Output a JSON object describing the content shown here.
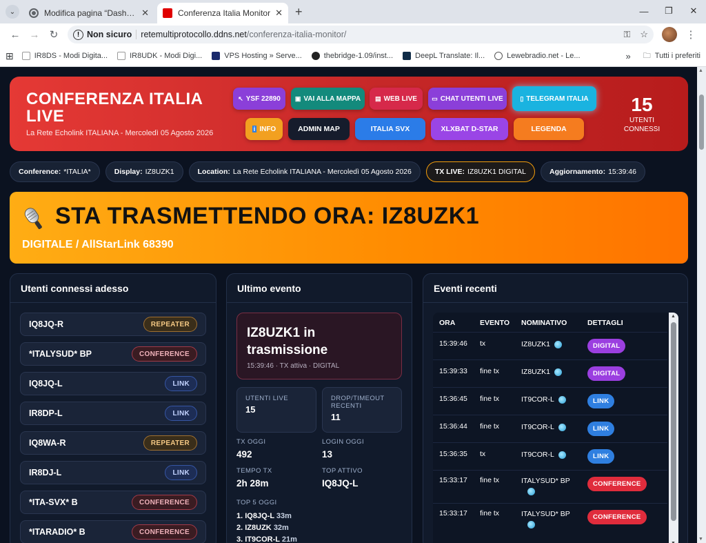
{
  "browser": {
    "tabs": [
      {
        "title": "Modifica pagina “Dashboard Li...",
        "close": "✕"
      },
      {
        "title": "Conferenza Italia Monitor",
        "close": "✕"
      }
    ],
    "new_tab": "+",
    "window_controls": {
      "minimize": "—",
      "restore": "❐",
      "close": "✕"
    },
    "address": {
      "security": "Non sicuro",
      "host": "retemultiprotocollo.ddns.net",
      "path": "/conferenza-italia-monitor/"
    },
    "bookmarks": [
      {
        "label": "IR8DS - Modi Digita..."
      },
      {
        "label": "IR8UDK - Modi Digi..."
      },
      {
        "label": "VPS Hosting » Serve..."
      },
      {
        "label": "thebridge-1.09/inst..."
      },
      {
        "label": "DeepL Translate: Il..."
      },
      {
        "label": "Lewebradio.net - Le..."
      }
    ],
    "bookmarks_overflow": "»",
    "bookmarks_folder": "Tutti i preferiti"
  },
  "hero": {
    "title_line1": "CONFERENZA ITALIA",
    "title_line2": "LIVE",
    "subtitle": "La Rete Echolink ITALIANA - Mercoledì 05 Agosto 2026",
    "buttons": {
      "ysf": "YSF 22890",
      "mappa": "VAI ALLA MAPPA",
      "weblive": "WEB LIVE",
      "chat": "CHAT UTENTI LIVE",
      "telegram": "TELEGRAM ITALIA",
      "info": "INFO",
      "admin": "ADMIN MAP",
      "svx": "ITALIA SVX",
      "xlx": "XLXBAT D-STAR",
      "legenda": "LEGENDA"
    },
    "connected_count": "15",
    "connected_label1": "UTENTI",
    "connected_label2": "CONNESSI"
  },
  "pills": {
    "conference_k": "Conference:",
    "conference_v": "*ITALIA*",
    "display_k": "Display:",
    "display_v": "IZ8UZK1",
    "location_k": "Location:",
    "location_v": "La Rete Echolink ITALIANA - Mercoledì 05 Agosto 2026",
    "txlive_k": "TX LIVE:",
    "txlive_v": "IZ8UZK1 DIGITAL",
    "update_k": "Aggiornamento:",
    "update_v": "15:39:46"
  },
  "tx": {
    "title": "STA TRASMETTENDO ORA: IZ8UZK1",
    "subtitle": "DIGITALE / AllStarLink 68390"
  },
  "users": {
    "heading": "Utenti connessi adesso",
    "items": [
      {
        "call": "IQ8JQ-R",
        "type": "REPEATER"
      },
      {
        "call": "*ITALYSUD* BP",
        "type": "CONFERENCE"
      },
      {
        "call": "IQ8JQ-L",
        "type": "LINK"
      },
      {
        "call": "IR8DP-L",
        "type": "LINK"
      },
      {
        "call": "IQ8WA-R",
        "type": "REPEATER"
      },
      {
        "call": "IR8DJ-L",
        "type": "LINK"
      },
      {
        "call": "*ITA-SVX* B",
        "type": "CONFERENCE"
      },
      {
        "call": "*ITARADIO* B",
        "type": "CONFERENCE"
      }
    ]
  },
  "last": {
    "heading": "Ultimo evento",
    "event_title": "IZ8UZK1 in trasmissione",
    "event_meta": "15:39:46 · TX attiva · DIGITAL",
    "utenti_live_label": "UTENTI LIVE",
    "utenti_live_value": "15",
    "drop_label": "DROP/TIMEOUT RECENTI",
    "drop_value": "11",
    "tx_oggi_label": "TX OGGI",
    "tx_oggi_value": "492",
    "login_oggi_label": "LOGIN OGGI",
    "login_oggi_value": "13",
    "tempo_tx_label": "TEMPO TX",
    "tempo_tx_value": "2h 28m",
    "top_attivo_label": "TOP ATTIVO",
    "top_attivo_value": "IQ8JQ-L",
    "top5_label": "TOP 5 OGGI",
    "top5": [
      {
        "rank": "1.",
        "call": "IQ8JQ-L",
        "time": "33m"
      },
      {
        "rank": "2.",
        "call": "IZ8UZK",
        "time": "32m"
      },
      {
        "rank": "3.",
        "call": "IT9COR-L",
        "time": "21m"
      }
    ]
  },
  "recent": {
    "heading": "Eventi recenti",
    "columns": {
      "ora": "ORA",
      "evento": "EVENTO",
      "nominativo": "NOMINATIVO",
      "dettagli": "DETTAGLI"
    },
    "rows": [
      {
        "ora": "15:39:46",
        "evento": "tx",
        "nominativo": "IZ8UZK1",
        "dettagli": "DIGITAL"
      },
      {
        "ora": "15:39:33",
        "evento": "fine tx",
        "nominativo": "IZ8UZK1",
        "dettagli": "DIGITAL"
      },
      {
        "ora": "15:36:45",
        "evento": "fine tx",
        "nominativo": "IT9COR-L",
        "dettagli": "LINK"
      },
      {
        "ora": "15:36:44",
        "evento": "fine tx",
        "nominativo": "IT9COR-L",
        "dettagli": "LINK"
      },
      {
        "ora": "15:36:35",
        "evento": "tx",
        "nominativo": "IT9COR-L",
        "dettagli": "LINK"
      },
      {
        "ora": "15:33:17",
        "evento": "fine tx",
        "nominativo": "ITALYSUD* BP",
        "dettagli": "CONFERENCE"
      },
      {
        "ora": "15:33:17",
        "evento": "fine tx",
        "nominativo": "ITALYSUD* BP",
        "dettagli": "CONFERENCE"
      }
    ]
  }
}
